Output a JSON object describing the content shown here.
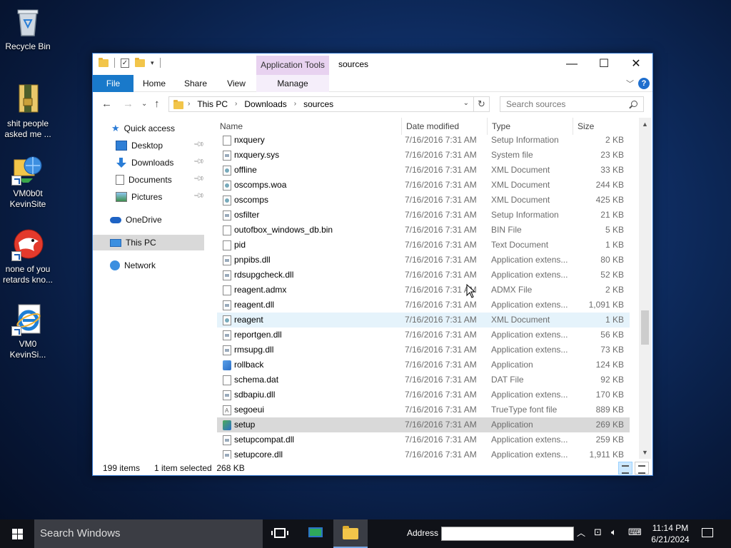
{
  "desktop": {
    "icons": [
      {
        "label_1": "Recycle Bin",
        "label_2": ""
      },
      {
        "label_1": "shit people",
        "label_2": "asked me ..."
      },
      {
        "label_1": "VM0b0t",
        "label_2": "KevinSite"
      },
      {
        "label_1": "none of you",
        "label_2": "retards kno..."
      },
      {
        "label_1": "VM0",
        "label_2": "KevinSi..."
      }
    ]
  },
  "window": {
    "title": "sources",
    "contextual_tab": "Application Tools",
    "ribbon_tabs": {
      "file": "File",
      "home": "Home",
      "share": "Share",
      "view": "View",
      "manage": "Manage"
    },
    "controls": {
      "minimize": "—",
      "maximize": "☐",
      "close": "✕"
    },
    "help_label": "?"
  },
  "address": {
    "crumbs": [
      "This PC",
      "Downloads",
      "sources"
    ],
    "search_placeholder": "Search sources"
  },
  "nav": {
    "items": [
      "Quick access",
      "Desktop",
      "Downloads",
      "Documents",
      "Pictures",
      "OneDrive",
      "This PC",
      "Network"
    ],
    "selected": "This PC"
  },
  "columns": {
    "name": "Name",
    "date": "Date modified",
    "type": "Type",
    "size": "Size"
  },
  "files": [
    {
      "name": "nxquery",
      "date": "7/16/2016 7:31 AM",
      "type": "Setup Information",
      "size": "2 KB",
      "icon": "file"
    },
    {
      "name": "nxquery.sys",
      "date": "7/16/2016 7:31 AM",
      "type": "System file",
      "size": "23 KB",
      "icon": "dll"
    },
    {
      "name": "offline",
      "date": "7/16/2016 7:31 AM",
      "type": "XML Document",
      "size": "33 KB",
      "icon": "xml"
    },
    {
      "name": "oscomps.woa",
      "date": "7/16/2016 7:31 AM",
      "type": "XML Document",
      "size": "244 KB",
      "icon": "xml"
    },
    {
      "name": "oscomps",
      "date": "7/16/2016 7:31 AM",
      "type": "XML Document",
      "size": "425 KB",
      "icon": "xml"
    },
    {
      "name": "osfilter",
      "date": "7/16/2016 7:31 AM",
      "type": "Setup Information",
      "size": "21 KB",
      "icon": "dll"
    },
    {
      "name": "outofbox_windows_db.bin",
      "date": "7/16/2016 7:31 AM",
      "type": "BIN File",
      "size": "5 KB",
      "icon": "file"
    },
    {
      "name": "pid",
      "date": "7/16/2016 7:31 AM",
      "type": "Text Document",
      "size": "1 KB",
      "icon": "file"
    },
    {
      "name": "pnpibs.dll",
      "date": "7/16/2016 7:31 AM",
      "type": "Application extens...",
      "size": "80 KB",
      "icon": "dll"
    },
    {
      "name": "rdsupgcheck.dll",
      "date": "7/16/2016 7:31 AM",
      "type": "Application extens...",
      "size": "52 KB",
      "icon": "dll"
    },
    {
      "name": "reagent.admx",
      "date": "7/16/2016 7:31 AM",
      "type": "ADMX File",
      "size": "2 KB",
      "icon": "file"
    },
    {
      "name": "reagent.dll",
      "date": "7/16/2016 7:31 AM",
      "type": "Application extens...",
      "size": "1,091 KB",
      "icon": "dll"
    },
    {
      "name": "reagent",
      "date": "7/16/2016 7:31 AM",
      "type": "XML Document",
      "size": "1 KB",
      "icon": "xml",
      "state": "hover"
    },
    {
      "name": "reportgen.dll",
      "date": "7/16/2016 7:31 AM",
      "type": "Application extens...",
      "size": "56 KB",
      "icon": "dll"
    },
    {
      "name": "rmsupg.dll",
      "date": "7/16/2016 7:31 AM",
      "type": "Application extens...",
      "size": "73 KB",
      "icon": "dll"
    },
    {
      "name": "rollback",
      "date": "7/16/2016 7:31 AM",
      "type": "Application",
      "size": "124 KB",
      "icon": "app"
    },
    {
      "name": "schema.dat",
      "date": "7/16/2016 7:31 AM",
      "type": "DAT File",
      "size": "92 KB",
      "icon": "file"
    },
    {
      "name": "sdbapiu.dll",
      "date": "7/16/2016 7:31 AM",
      "type": "Application extens...",
      "size": "170 KB",
      "icon": "dll"
    },
    {
      "name": "segoeui",
      "date": "7/16/2016 7:31 AM",
      "type": "TrueType font file",
      "size": "889 KB",
      "icon": "font"
    },
    {
      "name": "setup",
      "date": "7/16/2016 7:31 AM",
      "type": "Application",
      "size": "269 KB",
      "icon": "setup",
      "state": "selected"
    },
    {
      "name": "setupcompat.dll",
      "date": "7/16/2016 7:31 AM",
      "type": "Application extens...",
      "size": "259 KB",
      "icon": "dll"
    },
    {
      "name": "setupcore.dll",
      "date": "7/16/2016 7:31 AM",
      "type": "Application extens...",
      "size": "1,911 KB",
      "icon": "dll"
    }
  ],
  "status": {
    "count": "199 items",
    "selection": "1 item selected  268 KB"
  },
  "taskbar": {
    "search_placeholder": "Search Windows",
    "address_label": "Address",
    "time": "11:14 PM",
    "date": "6/21/2024"
  },
  "colors": {
    "accent": "#1979ca",
    "context_tab": "#e8d2f0",
    "selected_row": "#d9d9d9",
    "hover_row": "#e5f3fb"
  }
}
